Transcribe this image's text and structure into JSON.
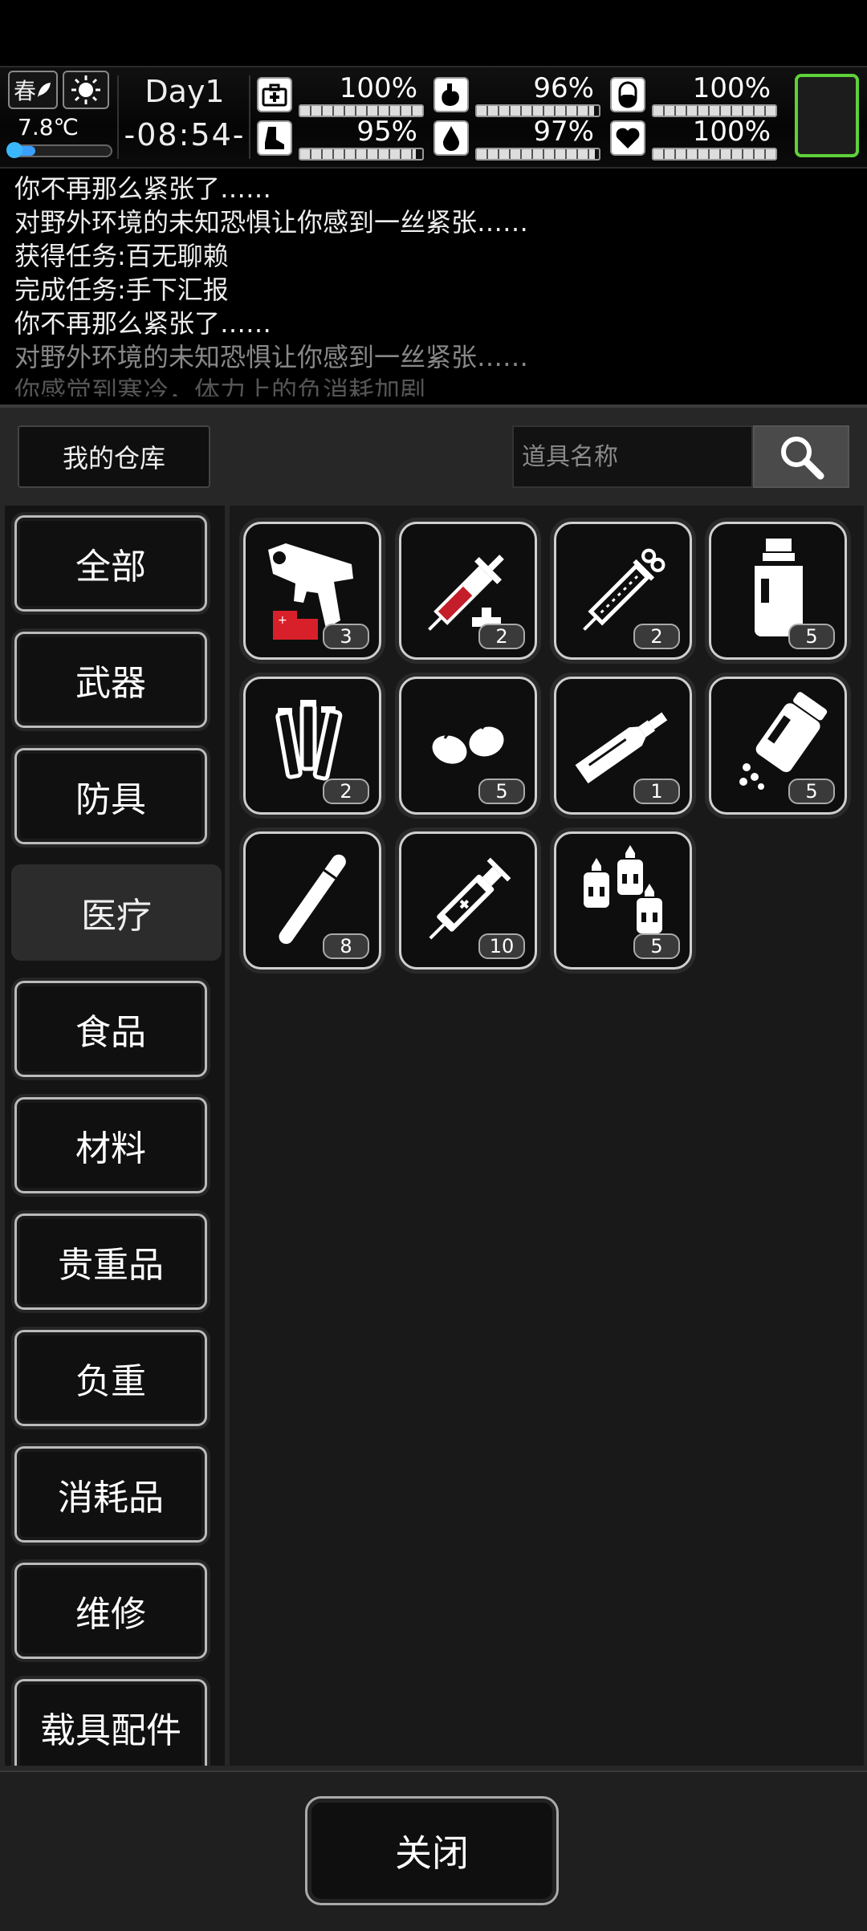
{
  "status": {
    "season": "春",
    "temperature": "7.8℃",
    "temperature_level": 0.25,
    "day": "Day1",
    "time": "-08:54-",
    "stats": [
      {
        "name": "health",
        "icon": "medkit-icon",
        "value": "100%",
        "level": 1.0
      },
      {
        "name": "hunger",
        "icon": "stomach-icon",
        "value": "96%",
        "level": 0.96
      },
      {
        "name": "medicine",
        "icon": "pill-icon",
        "value": "100%",
        "level": 1.0
      },
      {
        "name": "stamina",
        "icon": "boot-icon",
        "value": "95%",
        "level": 0.95
      },
      {
        "name": "thirst",
        "icon": "water-drop-icon",
        "value": "97%",
        "level": 0.97
      },
      {
        "name": "mood",
        "icon": "heart-icon",
        "value": "100%",
        "level": 1.0
      }
    ],
    "portrait_border_color": "#5fd13a"
  },
  "log": [
    "你不再那么紧张了……",
    "对野外环境的未知恐惧让你感到一丝紧张……",
    "获得任务:百无聊赖",
    "完成任务:手下汇报",
    "你不再那么紧张了……",
    "对野外环境的未知恐惧让你感到一丝紧张……",
    "你感觉到寒冷，体力上的负消耗加剧"
  ],
  "warehouse": {
    "title": "我的仓库",
    "search_placeholder": "道具名称"
  },
  "categories": [
    {
      "label": "全部",
      "active": false
    },
    {
      "label": "武器",
      "active": false
    },
    {
      "label": "防具",
      "active": false
    },
    {
      "label": "医疗",
      "active": true
    },
    {
      "label": "食品",
      "active": false
    },
    {
      "label": "材料",
      "active": false
    },
    {
      "label": "贵重品",
      "active": false
    },
    {
      "label": "负重",
      "active": false
    },
    {
      "label": "消耗品",
      "active": false
    },
    {
      "label": "维修",
      "active": false
    },
    {
      "label": "载具配件",
      "active": false
    }
  ],
  "items": [
    {
      "icon": "flare-gun-icon",
      "count": "3"
    },
    {
      "icon": "blood-syringe-icon",
      "count": "2"
    },
    {
      "icon": "syringe-icon",
      "count": "2"
    },
    {
      "icon": "medicine-bottle-icon",
      "count": "5"
    },
    {
      "icon": "vials-icon",
      "count": "2"
    },
    {
      "icon": "seeds-icon",
      "count": "5"
    },
    {
      "icon": "ointment-tube-icon",
      "count": "1"
    },
    {
      "icon": "pill-bottle-icon",
      "count": "5"
    },
    {
      "icon": "cigarette-icon",
      "count": "8"
    },
    {
      "icon": "adrenaline-syringe-icon",
      "count": "10"
    },
    {
      "icon": "eye-drops-icon",
      "count": "5"
    }
  ],
  "close_label": "关闭"
}
